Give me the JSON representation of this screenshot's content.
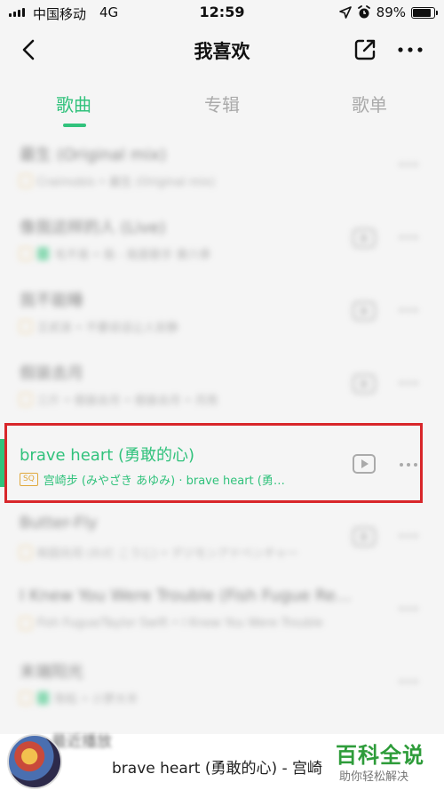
{
  "status": {
    "carrier": "中国移动",
    "network": "4G",
    "time": "12:59",
    "battery": "89%",
    "battery_level": 0.89
  },
  "header": {
    "title": "我喜欢"
  },
  "tabs": [
    {
      "label": "歌曲",
      "active": true
    },
    {
      "label": "专辑",
      "active": false
    },
    {
      "label": "歌单",
      "active": false
    }
  ],
  "songs": [
    {
      "title": "最生 (Original mix)",
      "sub": "Craimobis • 最生 (Original mix)"
    },
    {
      "title": "像我这样的人 (Live)",
      "sub": "毛不易 • 我 - 我是歌手 第六季"
    },
    {
      "title": "我不能睡",
      "sub": "王贰浪 • 不要说话让人安静"
    },
    {
      "title": "假装去月",
      "sub": "三斤 • 假装去月 • 假装去月 • 月亮"
    },
    {
      "title": "brave heart (勇敢的心)",
      "tag": "SQ",
      "sub": "宫崎步 (みやざき あゆみ) · brave heart (勇…"
    },
    {
      "title": "Butter-Fly",
      "sub": "和田光司 (わだ こうじ) • デジモンアドベンチャー"
    },
    {
      "title": "I Knew You Were Trouble (Fish Fugue Re…",
      "sub": "Fish Fugue/Taylor Swift • I Knew You Were Trouble"
    },
    {
      "title": "末端阳光",
      "sub": "陈粒 • 小梦大半"
    }
  ],
  "miniplayer": {
    "header": "最近播放",
    "now_playing": "brave heart (勇敢的心) - 宫崎"
  },
  "watermark": {
    "main": "百科全说",
    "sub": "助你轻松解决"
  },
  "colors": {
    "accent": "#31c27c",
    "highlight": "#d8262a"
  }
}
